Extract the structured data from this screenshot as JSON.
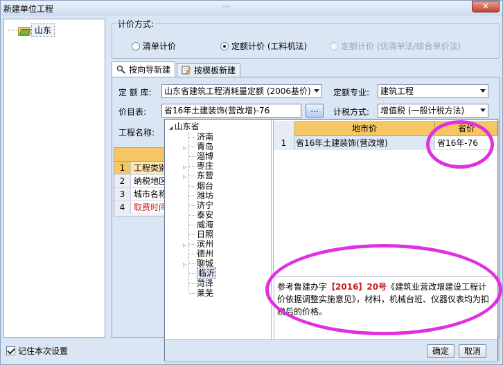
{
  "window": {
    "title": "新建单位工程",
    "close_glyph": "✕"
  },
  "left_tree": {
    "root_label": "山东"
  },
  "calc_method": {
    "title": "计价方式:",
    "options": [
      {
        "label": "清单计价",
        "selected": false,
        "enabled": true
      },
      {
        "label": "定额计价 (工料机法)",
        "selected": true,
        "enabled": true
      },
      {
        "label": "定额计价 (仿清单法/综合单价法)",
        "selected": false,
        "enabled": false
      }
    ]
  },
  "tabs": [
    {
      "label": "按向导新建",
      "active": true,
      "icon": "wizard-icon"
    },
    {
      "label": "按模板新建",
      "active": false,
      "icon": "template-icon"
    }
  ],
  "form": {
    "quota_lib_label": "定 额 库:",
    "quota_lib_value": "山东省建筑工程消耗量定额 (2006基价)",
    "quota_major_label": "定额专业:",
    "quota_major_value": "建筑工程",
    "price_table_label": "价目表:",
    "price_table_value": "省16年土建装饰(营改增)-76",
    "browse_label": "...",
    "tax_method_label": "计税方式:",
    "tax_method_value": "增值税 (一般计税方法)",
    "project_name_label": "工程名称:"
  },
  "background_grid": {
    "rows": [
      {
        "num": "1",
        "text": "工程类别"
      },
      {
        "num": "2",
        "text": "纳税地区"
      },
      {
        "num": "3",
        "text": "城市名称"
      },
      {
        "num": "4",
        "text": "取费时间"
      }
    ]
  },
  "region_tree": {
    "root": "山东省",
    "cities": [
      {
        "name": "济南",
        "expandable": false
      },
      {
        "name": "青岛",
        "expandable": true
      },
      {
        "name": "淄博",
        "expandable": false
      },
      {
        "name": "枣庄",
        "expandable": true
      },
      {
        "name": "东营",
        "expandable": true
      },
      {
        "name": "烟台",
        "expandable": false
      },
      {
        "name": "潍坊",
        "expandable": false
      },
      {
        "name": "济宁",
        "expandable": false
      },
      {
        "name": "泰安",
        "expandable": false
      },
      {
        "name": "威海",
        "expandable": false
      },
      {
        "name": "日照",
        "expandable": false
      },
      {
        "name": "滨州",
        "expandable": true
      },
      {
        "name": "德州",
        "expandable": false
      },
      {
        "name": "聊城",
        "expandable": true
      },
      {
        "name": "临沂",
        "expandable": false,
        "selected": true
      },
      {
        "name": "菏泽",
        "expandable": false
      },
      {
        "name": "莱芜",
        "expandable": false
      }
    ]
  },
  "price_grid": {
    "headers": [
      "地市价",
      "省价"
    ],
    "rows": [
      {
        "num": "1",
        "name": "省16年土建装饰(营改增)",
        "code": "省16年-76"
      }
    ]
  },
  "note": {
    "prefix": "参考鲁建办字",
    "year": "【2016】",
    "number": "20号",
    "body": "《建筑业营改增建设工程计价依据调整实施意见》，材料，机械台班、仪器仪表均为扣税后的价格。"
  },
  "buttons": {
    "ok": "确定",
    "cancel": "取消"
  },
  "remember": {
    "label": "记住本次设置",
    "checked": true
  },
  "colors": {
    "annotation": "#e030e0",
    "header": "#f5c663",
    "red_text": "#c62020"
  }
}
